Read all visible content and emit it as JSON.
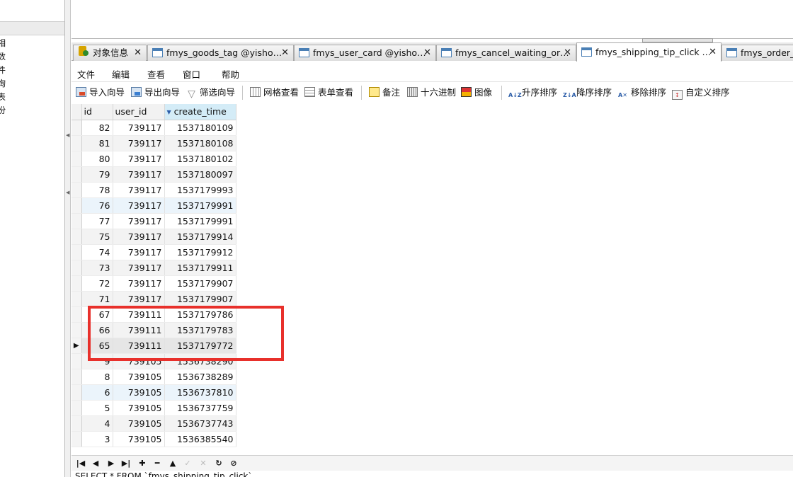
{
  "left_panel": {
    "items": [
      "相",
      "数",
      "件",
      "询",
      "表",
      "份"
    ]
  },
  "tabs": [
    {
      "label": "对象信息",
      "active": false,
      "icon": "object-info-icon"
    },
    {
      "label": "fmys_goods_tag @yisho…",
      "active": false,
      "icon": "table-icon"
    },
    {
      "label": "fmys_user_card @yisho…",
      "active": false,
      "icon": "table-icon"
    },
    {
      "label": "fmys_cancel_waiting_or…",
      "active": false,
      "icon": "table-icon"
    },
    {
      "label": "fmys_shipping_tip_click …",
      "active": true,
      "icon": "table-icon"
    },
    {
      "label": "fmys_order_i",
      "active": false,
      "icon": "table-icon"
    }
  ],
  "menu": [
    "文件",
    "编辑",
    "查看",
    "窗口",
    "帮助"
  ],
  "toolbar": {
    "import_wizard": "导入向导",
    "export_wizard": "导出向导",
    "filter_wizard": "筛选向导",
    "grid_view": "网格查看",
    "form_view": "表单查看",
    "memo": "备注",
    "hex": "十六进制",
    "image": "图像",
    "sort_asc": "升序排序",
    "sort_desc": "降序排序",
    "remove_sort": "移除排序",
    "custom_sort": "自定义排序"
  },
  "grid": {
    "columns": [
      "id",
      "user_id",
      "create_time"
    ],
    "sorted_column": "create_time",
    "sort_direction": "desc",
    "rows": [
      {
        "id": "82",
        "user_id": "739117",
        "create_time": "1537180109"
      },
      {
        "id": "81",
        "user_id": "739117",
        "create_time": "1537180108"
      },
      {
        "id": "80",
        "user_id": "739117",
        "create_time": "1537180102"
      },
      {
        "id": "79",
        "user_id": "739117",
        "create_time": "1537180097"
      },
      {
        "id": "78",
        "user_id": "739117",
        "create_time": "1537179993"
      },
      {
        "id": "76",
        "user_id": "739117",
        "create_time": "1537179991"
      },
      {
        "id": "77",
        "user_id": "739117",
        "create_time": "1537179991"
      },
      {
        "id": "75",
        "user_id": "739117",
        "create_time": "1537179914"
      },
      {
        "id": "74",
        "user_id": "739117",
        "create_time": "1537179912"
      },
      {
        "id": "73",
        "user_id": "739117",
        "create_time": "1537179911"
      },
      {
        "id": "72",
        "user_id": "739117",
        "create_time": "1537179907"
      },
      {
        "id": "71",
        "user_id": "739117",
        "create_time": "1537179907"
      },
      {
        "id": "67",
        "user_id": "739111",
        "create_time": "1537179786"
      },
      {
        "id": "66",
        "user_id": "739111",
        "create_time": "1537179783"
      },
      {
        "id": "65",
        "user_id": "739111",
        "create_time": "1537179772"
      },
      {
        "id": "9",
        "user_id": "739105",
        "create_time": "1536738290"
      },
      {
        "id": "8",
        "user_id": "739105",
        "create_time": "1536738289"
      },
      {
        "id": "6",
        "user_id": "739105",
        "create_time": "1536737810"
      },
      {
        "id": "5",
        "user_id": "739105",
        "create_time": "1536737759"
      },
      {
        "id": "4",
        "user_id": "739105",
        "create_time": "1536737743"
      },
      {
        "id": "3",
        "user_id": "739105",
        "create_time": "1536385540"
      }
    ],
    "current_row_id": "65",
    "highlight_row_ids": [
      "76",
      "6"
    ]
  },
  "nav": {
    "buttons": [
      "first-record",
      "prior-record",
      "next-record",
      "last-record",
      "insert-record",
      "delete-record",
      "edit-record",
      "post-edit",
      "cancel-edit",
      "refresh",
      "stop"
    ]
  },
  "status": {
    "sql": "SELECT * FROM `fmys_shipping_tip_click`"
  },
  "colors": {
    "annotation_box": "#e8302b",
    "sorted_header": "#d4ecf7"
  }
}
